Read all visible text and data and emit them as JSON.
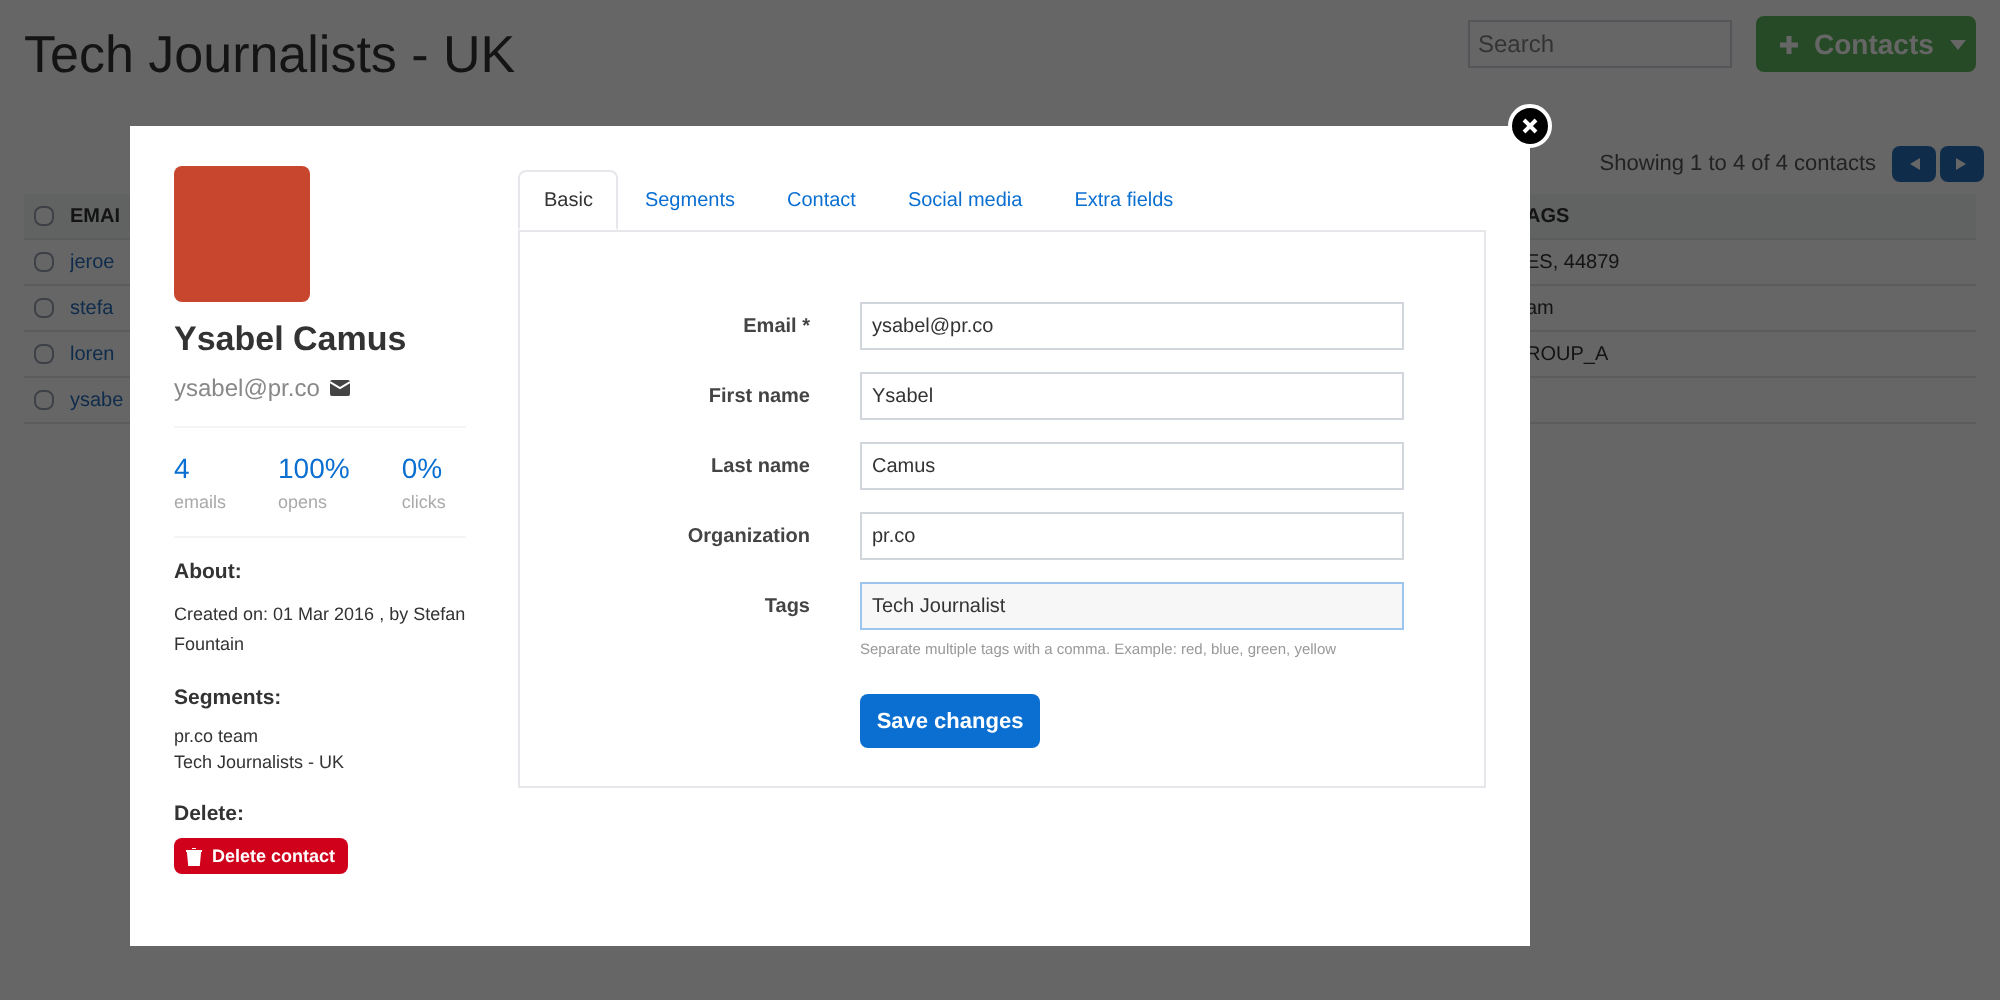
{
  "page": {
    "title": "Tech Journalists - UK",
    "search": {
      "placeholder": "Search"
    },
    "contacts_button": "Contacts",
    "showing": "Showing 1 to 4 of 4 contacts"
  },
  "table": {
    "all_checked": false,
    "columns": [
      {
        "label": "EMAI"
      },
      {
        "label": "AGS"
      }
    ],
    "rows": [
      {
        "cells": [
          "jeroe",
          "ES, 44879"
        ],
        "checked": false
      },
      {
        "cells": [
          "stefa",
          "am"
        ],
        "checked": false
      },
      {
        "cells": [
          "loren",
          "ROUP_A"
        ],
        "checked": false
      },
      {
        "cells": [
          "ysabe",
          ""
        ],
        "checked": false
      }
    ]
  },
  "modal": {
    "profile": {
      "name": "Ysabel Camus",
      "email": "ysabel@pr.co",
      "stats": [
        {
          "value": "4",
          "label": "emails"
        },
        {
          "value": "100%",
          "label": "opens"
        },
        {
          "value": "0%",
          "label": "clicks"
        }
      ],
      "about_heading": "About:",
      "about_text": "Created on: 01 Mar 2016 , by Stefan Fountain",
      "segments_heading": "Segments:",
      "segments": [
        "pr.co team",
        "Tech Journalists - UK"
      ],
      "delete_heading": "Delete:",
      "delete_button": "Delete contact"
    },
    "tabs": [
      {
        "label": "Basic",
        "selected": true
      },
      {
        "label": "Segments",
        "selected": false
      },
      {
        "label": "Contact",
        "selected": false
      },
      {
        "label": "Social media",
        "selected": false
      },
      {
        "label": "Extra fields",
        "selected": false
      }
    ],
    "fields": [
      {
        "label": "Email *",
        "value": "ysabel@pr.co",
        "focused": false
      },
      {
        "label": "First name",
        "value": "Ysabel",
        "focused": false
      },
      {
        "label": "Last name",
        "value": "Camus",
        "focused": false
      },
      {
        "label": "Organization",
        "value": "pr.co",
        "focused": false
      },
      {
        "label": "Tags",
        "value": "Tech Journalist",
        "focused": true,
        "help": "Separate multiple tags with a comma. Example: red, blue, green, yellow"
      }
    ],
    "save_button": "Save changes"
  }
}
